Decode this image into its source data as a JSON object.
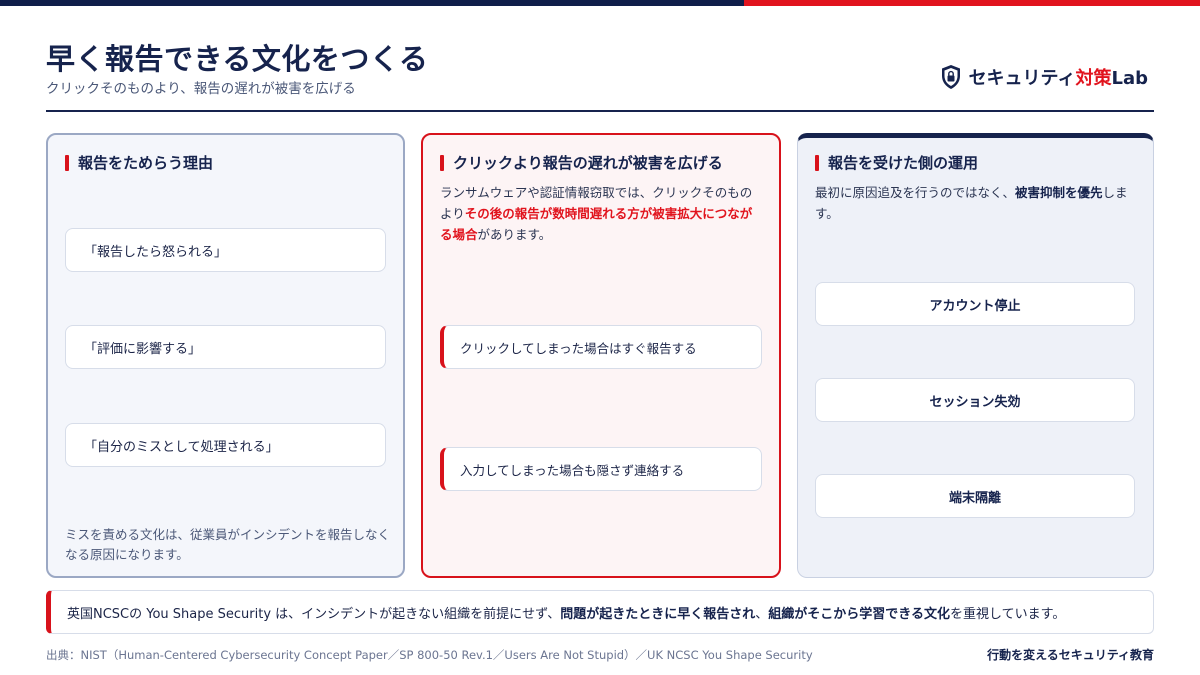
{
  "header": {
    "title": "早く報告できる文化をつくる",
    "subtitle": "クリックそのものより、報告の遅れが被害を広げる",
    "brand_main": "セキュリティ",
    "brand_accent": "対策",
    "brand_tail": "Lab",
    "brand_icon": "shield-lock-icon"
  },
  "cards": {
    "left": {
      "heading": "報告をためらう理由",
      "quotes": [
        "「報告したら怒られる」",
        "「評価に影響する」",
        "「自分のミスとして処理される」"
      ],
      "note": "ミスを責める文化は、従業員がインシデントを報告しなくなる原因になります。"
    },
    "middle": {
      "heading": "クリックより報告の遅れが被害を広げる",
      "desc_before": "ランサムウェアや認証情報窃取では、クリックそのものより",
      "desc_emphasis": "その後の報告が数時間遅れる方が被害拡大につながる場合",
      "desc_after": "があります。",
      "steps": [
        "クリックしてしまった場合はすぐ報告する",
        "入力してしまった場合も隠さず連絡する"
      ]
    },
    "right": {
      "heading": "報告を受けた側の運用",
      "desc_before": "最初に原因追及を行うのではなく、",
      "desc_emphasis": "被害抑制を優先",
      "desc_after": "します。",
      "actions": [
        "アカウント停止",
        "セッション失効",
        "端末隔離"
      ]
    }
  },
  "banner": {
    "part1": "英国NCSCの You Shape Security は、インシデントが起きない組織を前提にせず、",
    "bold1": "問題が起きたときに早く報告され",
    "part2": "、",
    "bold2": "組織がそこから学習できる文化",
    "part3": "を重視しています。"
  },
  "footer": {
    "source": "出典：NIST（Human-Centered Cybersecurity Concept Paper／SP 800-50 Rev.1／Users Are Not Stupid）／UK NCSC You Shape Security",
    "tagline": "行動を変えるセキュリティ教育"
  },
  "colors": {
    "navy": "#16234d",
    "red": "#e1141e"
  }
}
